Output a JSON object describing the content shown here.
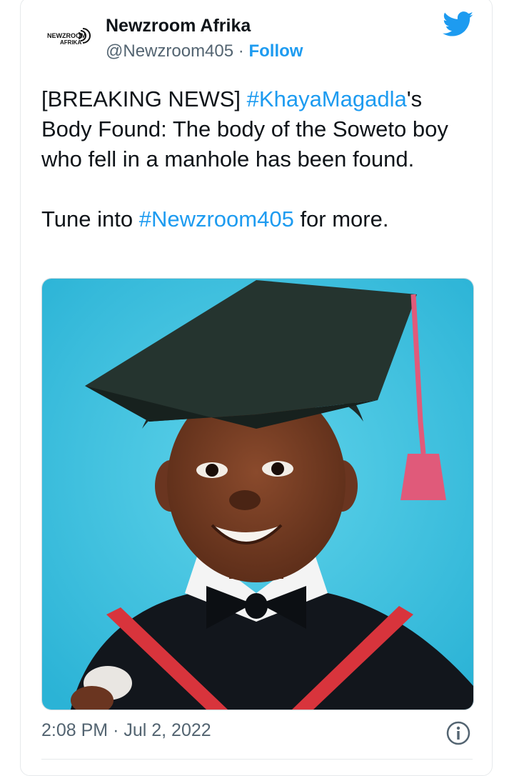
{
  "tweet": {
    "display_name": "Newzroom Afrika",
    "handle": "@Newzroom405",
    "separator": "·",
    "follow_label": "Follow",
    "text_part1": "[BREAKING NEWS] ",
    "hashtag1": "#KhayaMagadla",
    "text_part2": "'s Body Found: The body of the Soweto boy who fell in a manhole has been found.",
    "text_part3": "Tune into ",
    "hashtag2": "#Newzroom405",
    "text_part4": " for more.",
    "time": "2:08 PM",
    "date": "Jul 2, 2022",
    "date_separator": "·"
  },
  "logo": {
    "line1": "NEWZROOM",
    "line2": "AFRIKA"
  },
  "icons": {
    "brand": "twitter-bird-icon",
    "info": "info-icon"
  },
  "colors": {
    "accent": "#1d9bf0",
    "secondary_text": "#536471",
    "primary_text": "#0f1419"
  }
}
